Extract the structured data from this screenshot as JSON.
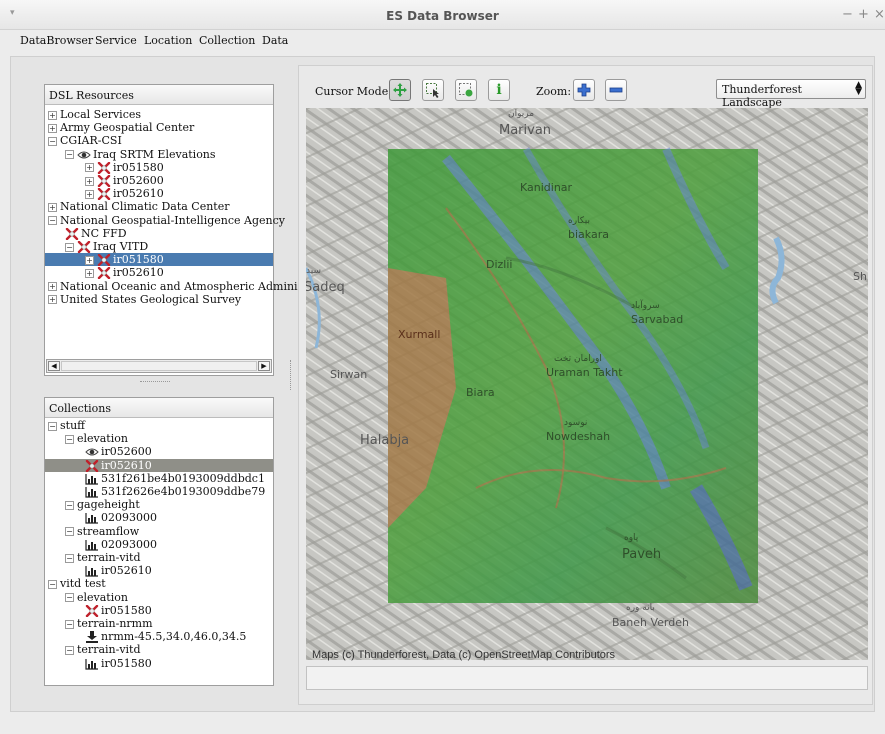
{
  "window": {
    "title": "ES Data Browser",
    "menu_glyph": "▾",
    "min_glyph": "−",
    "max_glyph": "+",
    "close_glyph": "×"
  },
  "menubar": [
    "DataBrowser",
    "Service",
    "Location",
    "Collection",
    "Data"
  ],
  "dsl": {
    "header": "DSL Resources",
    "rows": [
      {
        "label": "Local Services",
        "exp": "+",
        "depth": 0,
        "icon": ""
      },
      {
        "label": "Army Geospatial Center",
        "exp": "+",
        "depth": 0,
        "icon": ""
      },
      {
        "label": "CGIAR-CSI",
        "exp": "−",
        "depth": 0,
        "icon": ""
      },
      {
        "label": "Iraq SRTM Elevations",
        "exp": "−",
        "depth": 1,
        "icon": "eye-icon"
      },
      {
        "label": "ir051580",
        "exp": "+",
        "depth": 2,
        "icon": "x-marker-icon"
      },
      {
        "label": "ir052600",
        "exp": "+",
        "depth": 2,
        "icon": "x-marker-icon"
      },
      {
        "label": "ir052610",
        "exp": "+",
        "depth": 2,
        "icon": "x-marker-icon"
      },
      {
        "label": "National Climatic Data Center",
        "exp": "+",
        "depth": 0,
        "icon": ""
      },
      {
        "label": "National Geospatial-Intelligence Agency",
        "exp": "−",
        "depth": 0,
        "icon": ""
      },
      {
        "label": "NC FFD",
        "exp": "",
        "depth": 1,
        "icon": "x-marker-icon"
      },
      {
        "label": "Iraq VITD",
        "exp": "−",
        "depth": 1,
        "icon": "x-marker-icon"
      },
      {
        "label": "ir051580",
        "exp": "+",
        "depth": 2,
        "icon": "x-marker-icon",
        "selected": true
      },
      {
        "label": "ir052610",
        "exp": "+",
        "depth": 2,
        "icon": "x-marker-icon"
      },
      {
        "label": "National Oceanic and Atmospheric Administ",
        "exp": "+",
        "depth": 0,
        "icon": ""
      },
      {
        "label": "United States Geological Survey",
        "exp": "+",
        "depth": 0,
        "icon": ""
      }
    ],
    "scroll_grip": "|||"
  },
  "collections": {
    "header": "Collections",
    "rows": [
      {
        "label": "stuff",
        "exp": "−",
        "depth": 0,
        "icon": ""
      },
      {
        "label": "elevation",
        "exp": "−",
        "depth": 1,
        "icon": ""
      },
      {
        "label": "ir052600",
        "exp": "",
        "depth": 2,
        "icon": "eye-icon"
      },
      {
        "label": "ir052610",
        "exp": "",
        "depth": 2,
        "icon": "x-marker-icon",
        "selected": true
      },
      {
        "label": "531f261be4b0193009ddbdc1",
        "exp": "",
        "depth": 2,
        "icon": "chart-icon"
      },
      {
        "label": "531f2626e4b0193009ddbe79",
        "exp": "",
        "depth": 2,
        "icon": "chart-icon"
      },
      {
        "label": "gageheight",
        "exp": "−",
        "depth": 1,
        "icon": ""
      },
      {
        "label": "02093000",
        "exp": "",
        "depth": 2,
        "icon": "chart-icon"
      },
      {
        "label": "streamflow",
        "exp": "−",
        "depth": 1,
        "icon": ""
      },
      {
        "label": "02093000",
        "exp": "",
        "depth": 2,
        "icon": "chart-icon"
      },
      {
        "label": "terrain-vitd",
        "exp": "−",
        "depth": 1,
        "icon": ""
      },
      {
        "label": "ir052610",
        "exp": "",
        "depth": 2,
        "icon": "chart-icon"
      },
      {
        "label": "vitd test",
        "exp": "−",
        "depth": 0,
        "icon": ""
      },
      {
        "label": "elevation",
        "exp": "−",
        "depth": 1,
        "icon": ""
      },
      {
        "label": "ir051580",
        "exp": "",
        "depth": 2,
        "icon": "x-marker-icon"
      },
      {
        "label": "terrain-nrmm",
        "exp": "−",
        "depth": 1,
        "icon": ""
      },
      {
        "label": "nrmm-45.5,34.0,46.0,34.5",
        "exp": "",
        "depth": 2,
        "icon": "download-icon"
      },
      {
        "label": "terrain-vitd",
        "exp": "−",
        "depth": 1,
        "icon": ""
      },
      {
        "label": "ir051580",
        "exp": "",
        "depth": 2,
        "icon": "chart-icon"
      }
    ]
  },
  "toolbar": {
    "cursor_mode_label": "Cursor Mode:",
    "zoom_label": "Zoom:",
    "info_glyph": "i",
    "basemap": "Thunderforest Landscape"
  },
  "map": {
    "labels": [
      "Marivan",
      "Kanidinar",
      "biakara",
      "Dizlii",
      "Sadeq",
      "Sarvabad",
      "Xurmall",
      "Uraman Takht",
      "Sirwan",
      "Biara",
      "Halabja",
      "Nowdeshah",
      "Paveh",
      "Baneh Verdeh",
      "Sh"
    ],
    "script_labels": [
      "مریوان",
      "بيكاره",
      "سروآباد",
      "اورامان تخت",
      "نوسود",
      "پاوه",
      "بانه وره",
      "سيد"
    ],
    "attribution": "Maps (c) Thunderforest, Data (c) OpenStreetMap Contributors"
  },
  "colors": {
    "selection": "#4a7bb0",
    "selection_gray": "#8f8f88",
    "overlay_green": "#3f9a3a",
    "overlay_blue": "#5a78d8",
    "overlay_brown": "#b8704a"
  }
}
